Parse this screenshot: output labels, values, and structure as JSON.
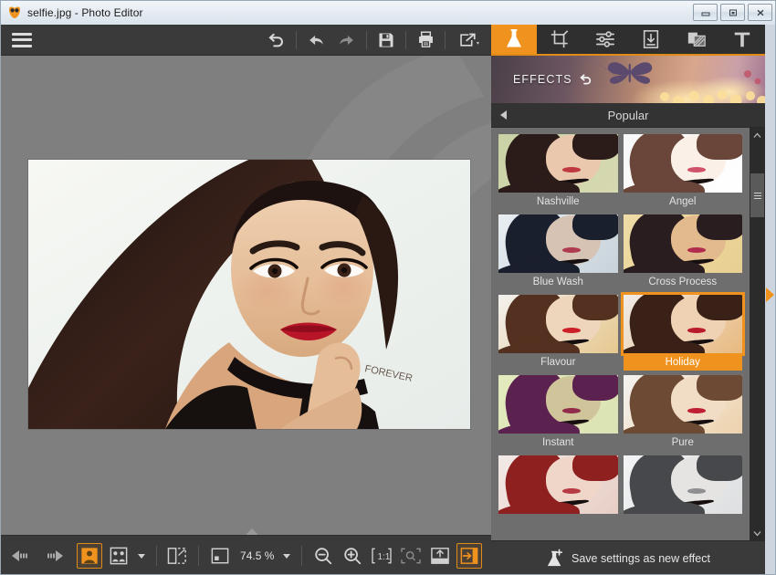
{
  "window": {
    "title": "selfie.jpg - Photo Editor",
    "app_icon": "mask-icon",
    "controls": [
      {
        "name": "minimize-button",
        "glyph": "–"
      },
      {
        "name": "restore-button",
        "glyph": "❐"
      },
      {
        "name": "close-button",
        "glyph": "✕"
      }
    ]
  },
  "toolbar": {
    "menu_icon": "hamburger-menu-icon",
    "items": [
      {
        "name": "reset-button",
        "icon": "reset-arrow-icon"
      },
      {
        "name": "undo-button",
        "icon": "undo-arrow-icon"
      },
      {
        "name": "redo-button",
        "icon": "redo-arrow-icon"
      },
      {
        "name": "save-button",
        "icon": "floppy-disk-icon"
      },
      {
        "name": "print-button",
        "icon": "printer-icon"
      },
      {
        "name": "share-button",
        "icon": "share-export-icon"
      }
    ]
  },
  "canvas": {
    "image_name": "selfie.jpg",
    "background_color": "#7f7f7f"
  },
  "bottom_bar": {
    "prev_label": "previous-image",
    "next_label": "next-image",
    "view_single": "single-view",
    "view_compare": "compare-view",
    "view_split": "split-view",
    "zoom_value": "74.5 %",
    "zoom_out": "zoom-out",
    "zoom_in": "zoom-in",
    "actual_size": "1:1",
    "fit_screen": "fit-to-screen",
    "upload": "upload-image",
    "export": "export-image"
  },
  "panel": {
    "tabs": [
      {
        "name": "tab-effects",
        "icon": "flask-icon",
        "active": true
      },
      {
        "name": "tab-crop",
        "icon": "crop-icon",
        "active": false
      },
      {
        "name": "tab-adjust",
        "icon": "sliders-icon",
        "active": false
      },
      {
        "name": "tab-frame",
        "icon": "frame-icon",
        "active": false
      },
      {
        "name": "tab-overlay",
        "icon": "overlay-layers-icon",
        "active": false
      },
      {
        "name": "tab-text",
        "icon": "text-t-icon",
        "active": false
      }
    ],
    "header_title": "EFFECTS",
    "header_reset_icon": "reset-arrow-icon",
    "category": "Popular",
    "effects": [
      {
        "name": "Nashville",
        "bg": "#c9d2a6",
        "hair": "#2b1c1a",
        "skin": "#e9c8ae",
        "lip": "#c0393f",
        "tone": "#d7d9b0"
      },
      {
        "name": "Angel",
        "bg": "#f7f7f7",
        "hair": "#6a463a",
        "skin": "#fbf0e7",
        "lip": "#d0526a",
        "tone": "#ffffff"
      },
      {
        "name": "Blue Wash",
        "bg": "#e8eef2",
        "hair": "#1a1f2e",
        "skin": "#d7c3b4",
        "lip": "#b03a50",
        "tone": "#c8d2da"
      },
      {
        "name": "Cross Process",
        "bg": "#efdca6",
        "hair": "#2a1d20",
        "skin": "#e3b98e",
        "lip": "#b02b4e",
        "tone": "#e8cf92"
      },
      {
        "name": "Flavour",
        "bg": "#f3f1ee",
        "hair": "#53301f",
        "skin": "#eed6bd",
        "lip": "#cc1f28",
        "tone": "#e6c88f"
      },
      {
        "name": "Holiday",
        "bg": "#f0ece8",
        "hair": "#3a2118",
        "skin": "#efd2b4",
        "lip": "#b81b2c",
        "tone": "#e8b97e",
        "selected": true
      },
      {
        "name": "Instant",
        "bg": "#e3ebbe",
        "hair": "#5b2250",
        "skin": "#cfc49a",
        "lip": "#912c4a",
        "tone": "#dbe3b4"
      },
      {
        "name": "Pure",
        "bg": "#f4f2f0",
        "hair": "#6d4a34",
        "skin": "#f1dcc6",
        "lip": "#c01f33",
        "tone": "#edd2ac"
      },
      {
        "name": "",
        "bg": "#f2e9e6",
        "hair": "#8e2020",
        "skin": "#efd6c8",
        "lip": "#b83a44",
        "tone": "#e8cfc6"
      },
      {
        "name": "",
        "bg": "#f2f4f5",
        "hair": "#47484c",
        "skin": "#e6e4e2",
        "lip": "#8f8f92",
        "tone": "#dedfe0"
      }
    ],
    "save_effect_label": "Save settings as new effect",
    "save_effect_icon": "flask-plus-icon",
    "collapse_icon": "collapse-panel-arrow"
  },
  "colors": {
    "accent": "#f0921e",
    "panel_bg": "#3c3c3c",
    "grid_bg": "#6e6e6e",
    "toolbar_bg": "#3a3a3a"
  }
}
